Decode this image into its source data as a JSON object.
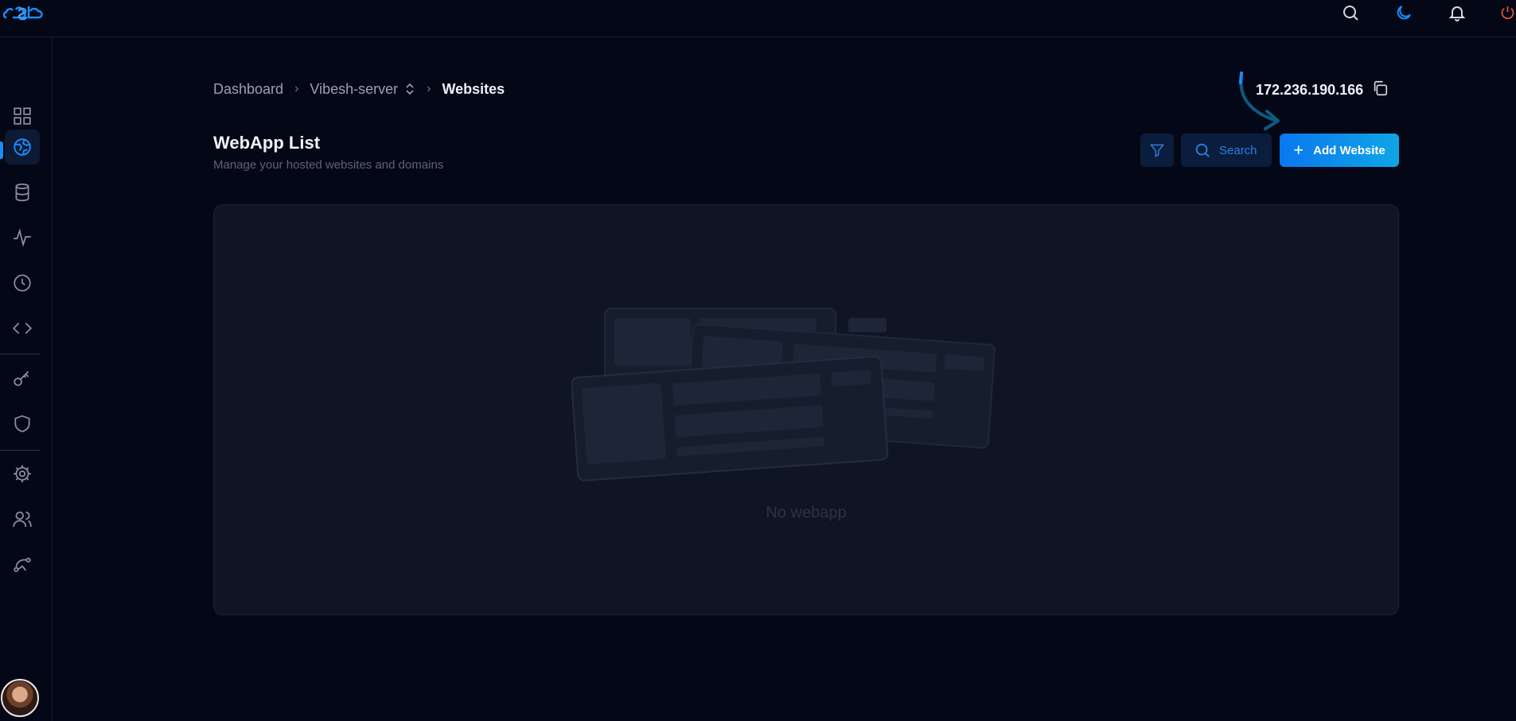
{
  "topbar": {
    "logo_icon": "cloud-logo-icon",
    "icons": [
      "search-icon",
      "moon-icon",
      "bell-icon",
      "power-icon"
    ]
  },
  "sidebar": {
    "items": [
      {
        "icon": "dashboard-grid-icon",
        "active": false
      },
      {
        "icon": "globe-icon",
        "active": true
      },
      {
        "icon": "database-icon",
        "active": false
      },
      {
        "icon": "activity-icon",
        "active": false
      },
      {
        "icon": "clock-icon",
        "active": false
      },
      {
        "icon": "code-icon",
        "active": false
      },
      {
        "icon": "key-icon",
        "active": false
      },
      {
        "icon": "shield-icon",
        "active": false
      },
      {
        "icon": "settings-gear-icon",
        "active": false
      },
      {
        "icon": "users-icon",
        "active": false
      },
      {
        "icon": "route-icon",
        "active": false
      }
    ],
    "avatar_icon": "user-avatar"
  },
  "breadcrumb": {
    "items": [
      "Dashboard",
      "Vibesh-server",
      "Websites"
    ]
  },
  "server_ip": "172.236.190.166",
  "page": {
    "title": "WebApp List",
    "subtitle": "Manage your hosted websites and domains"
  },
  "actions": {
    "search_label": "Search",
    "add_label": "Add Website"
  },
  "empty_state": {
    "message": "No webapp"
  },
  "colors": {
    "background": "#040816",
    "accent": "#0a78f0",
    "panel": "#0f1524"
  }
}
